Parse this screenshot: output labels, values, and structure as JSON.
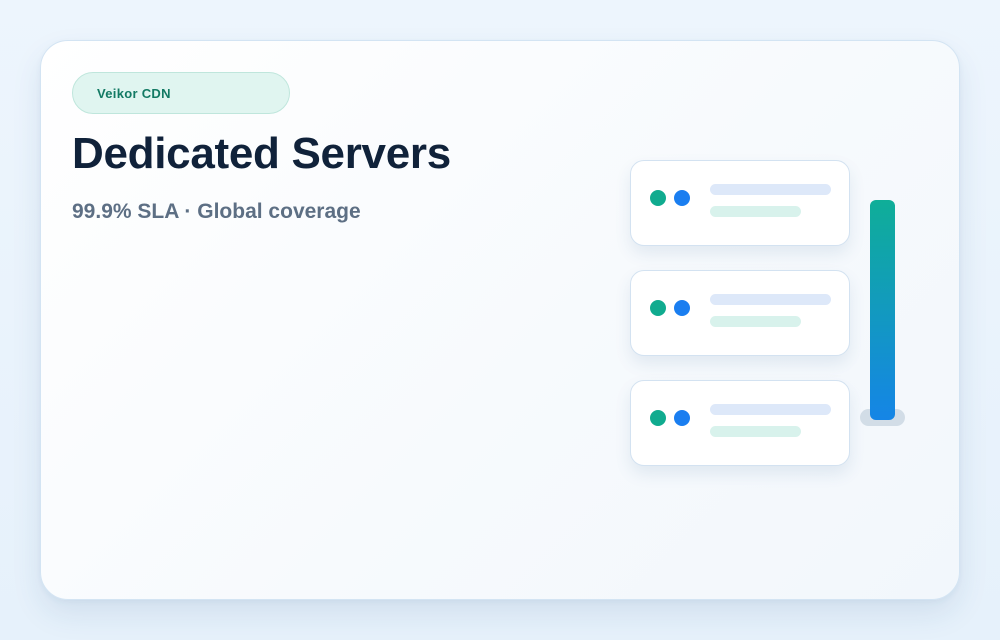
{
  "hero": {
    "badge": "Veikor CDN",
    "title": "Dedicated Servers",
    "subtitle": "99.9% SLA · Global coverage"
  },
  "illustration": {
    "server_count": 3,
    "colors": {
      "status_green": "#10ab8f",
      "status_blue": "#1a7ef0",
      "bar_gradient_top": "#0fae98",
      "bar_gradient_bottom": "#1585e6",
      "badge_text": "#137a64",
      "title_text": "#10223a",
      "subtitle_text": "#5d6f84"
    }
  }
}
